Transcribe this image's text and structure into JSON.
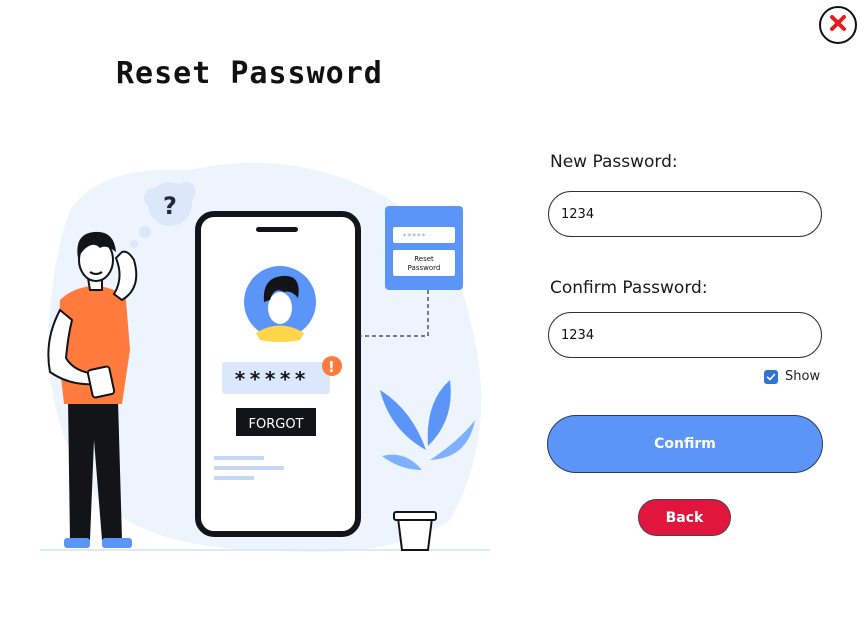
{
  "header": {
    "title": "Reset Password"
  },
  "form": {
    "new_password_label": "New Password:",
    "new_password_value": "1234",
    "confirm_password_label": "Confirm Password:",
    "confirm_password_value": "1234",
    "show_label": "Show",
    "show_checked": true,
    "confirm_label": "Confirm",
    "back_label": "Back"
  },
  "illustration": {
    "question_mark": "?",
    "password_mask": "*****",
    "forgot_label": "FORGOT",
    "alert_mark": "!",
    "card_mask": "*****",
    "card_reset_line1": "Reset",
    "card_reset_line2": "Password"
  },
  "colors": {
    "accent_blue": "#5b95f7",
    "back_red": "#e0163f",
    "close_red": "#e31b23",
    "shirt_orange": "#ff7a3d",
    "checkbox_blue": "#2f74d0"
  },
  "icons": {
    "close": "close-icon",
    "checkbox": "check-icon"
  }
}
